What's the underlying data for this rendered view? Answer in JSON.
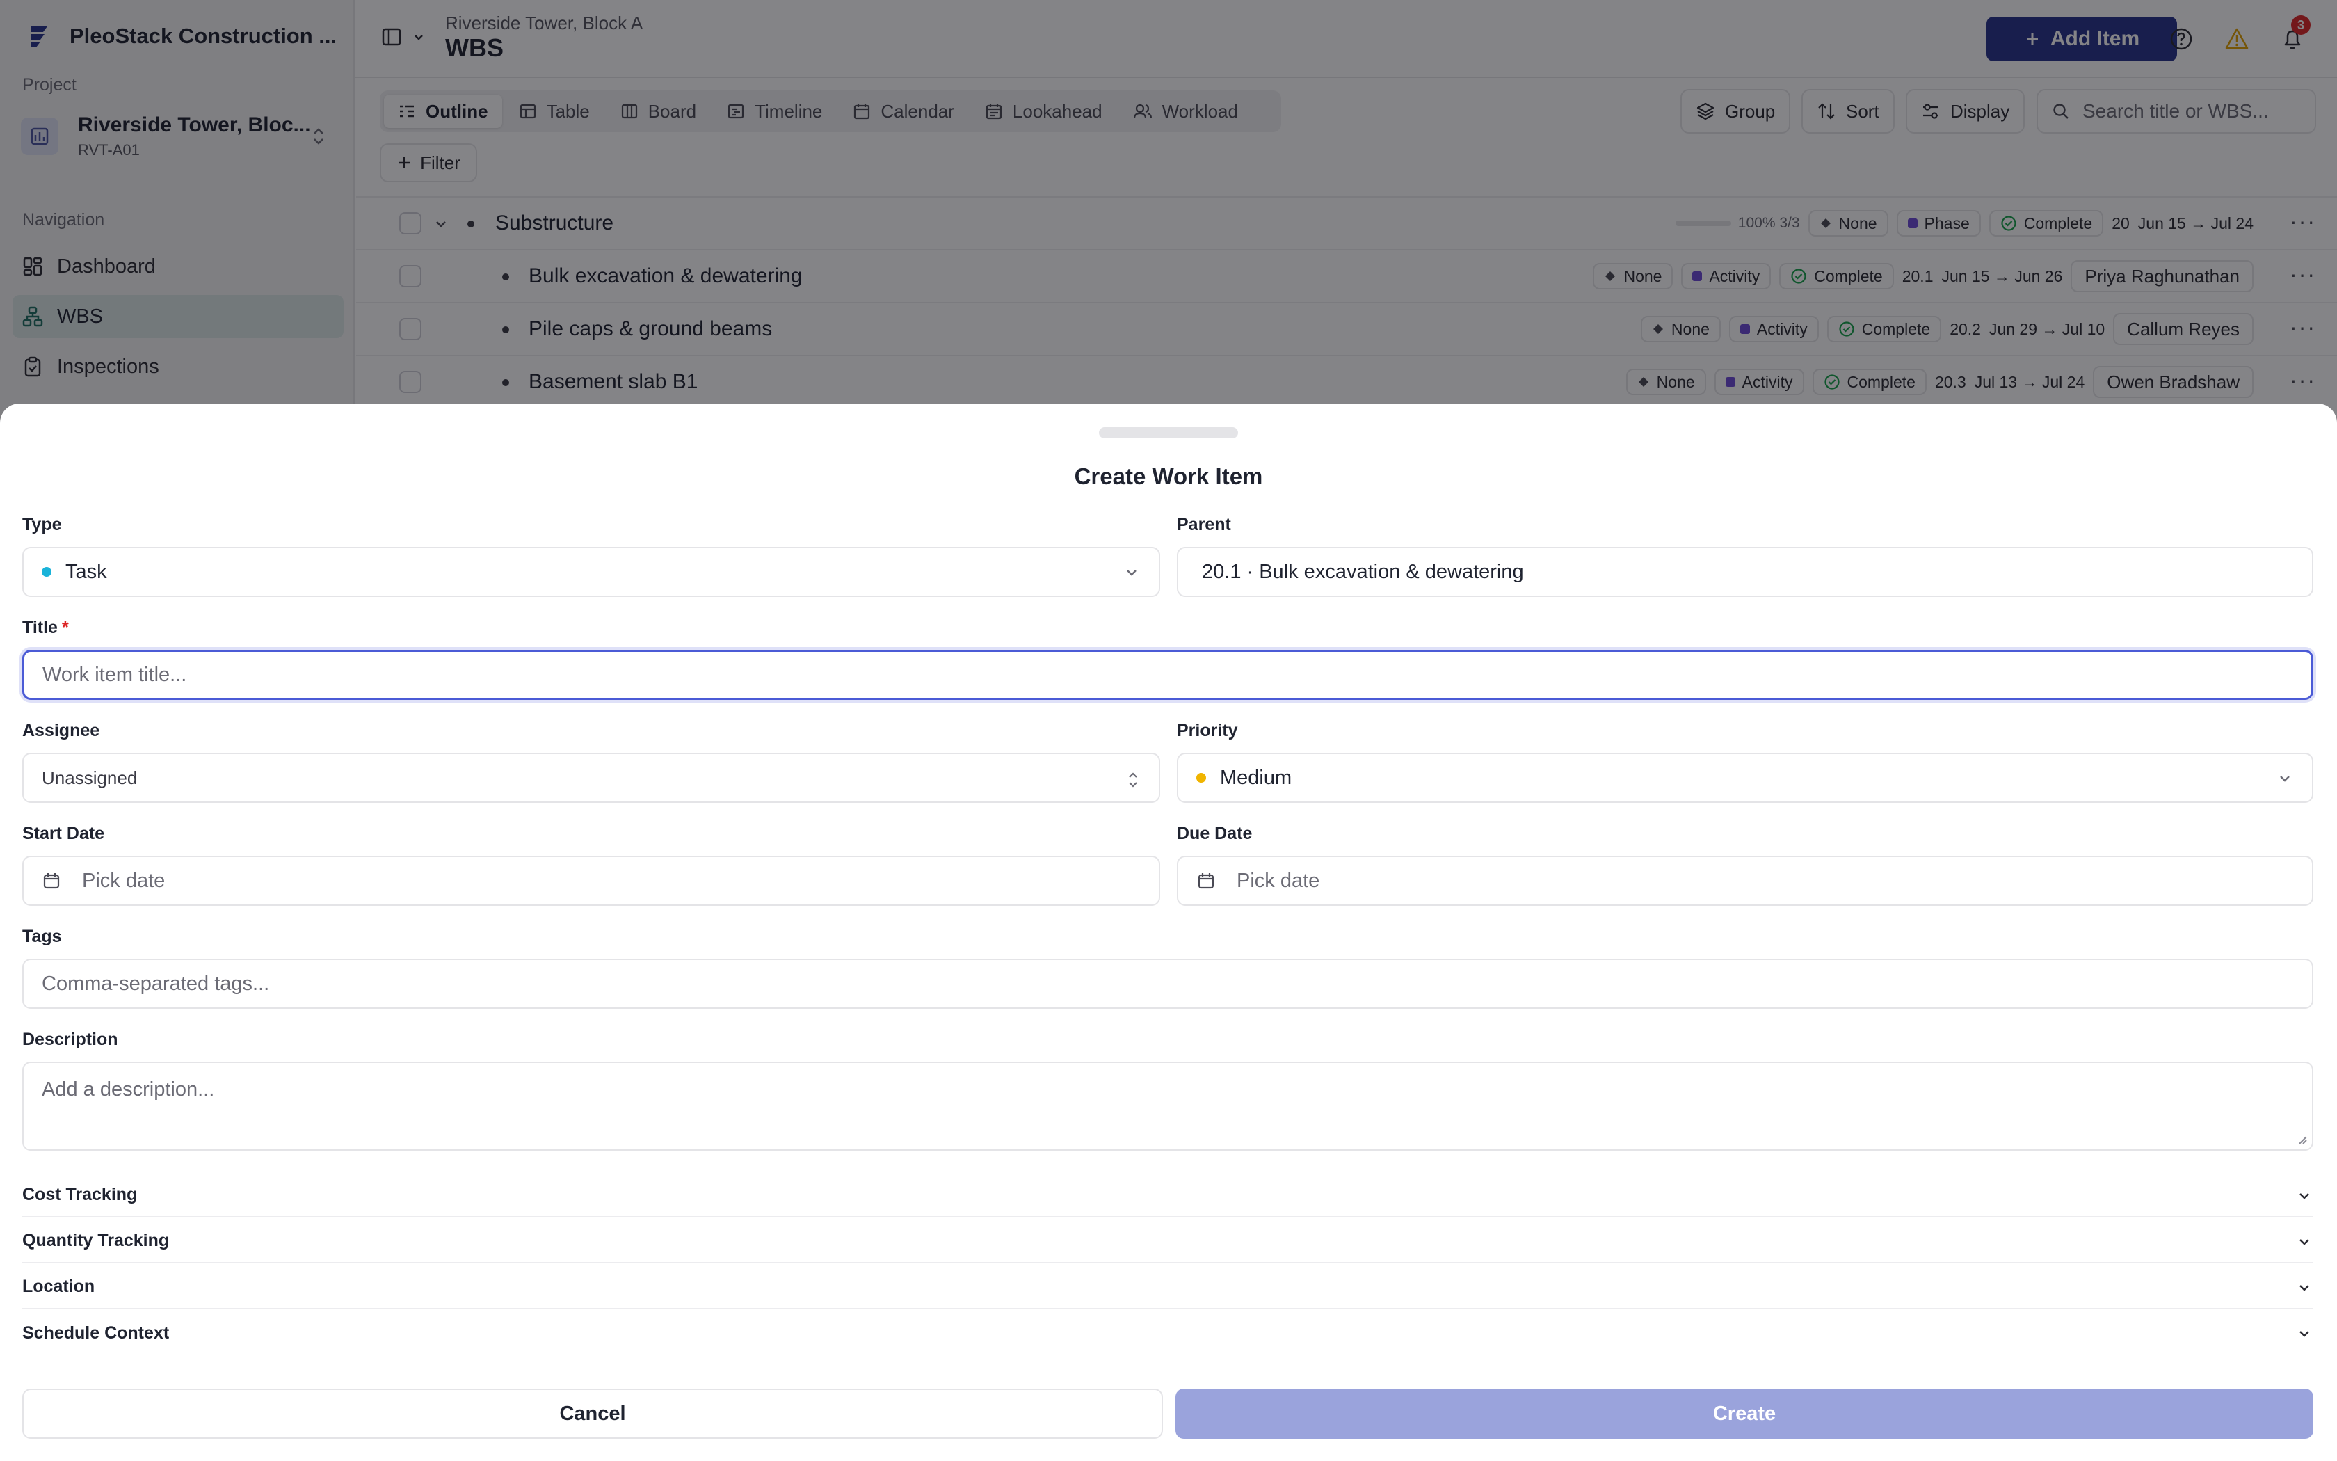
{
  "sidebar": {
    "org_name": "PleoStack Construction ...",
    "project_label": "Project",
    "project_name": "Riverside Tower, Bloc...",
    "project_code": "RVT-A01",
    "nav_label": "Navigation",
    "nav_items": [
      {
        "label": "Dashboard",
        "icon": "dashboard-icon",
        "active": false
      },
      {
        "label": "WBS",
        "icon": "hierarchy-icon",
        "active": true
      },
      {
        "label": "Inspections",
        "icon": "clipboard-check-icon",
        "active": false
      }
    ]
  },
  "header": {
    "breadcrumb": "Riverside Tower, Block A",
    "title": "WBS",
    "add_item_label": "Add Item",
    "notification_count": "3"
  },
  "view_tabs": [
    "Outline",
    "Table",
    "Board",
    "Timeline",
    "Calendar",
    "Lookahead",
    "Workload"
  ],
  "active_view": "Outline",
  "toolbar": {
    "group_label": "Group",
    "sort_label": "Sort",
    "display_label": "Display",
    "search_placeholder": "Search title or WBS...",
    "filter_label": "Filter"
  },
  "wbs_rows": [
    {
      "title": "Substructure",
      "level": 0,
      "progress_label": "100% 3/3",
      "progress_fraction": 1.0,
      "priority": "None",
      "type": "Phase",
      "status": "Complete",
      "code": "20",
      "dates": "Jun 15 → Jul 24",
      "assignee": ""
    },
    {
      "title": "Bulk excavation & dewatering",
      "level": 1,
      "priority": "None",
      "type": "Activity",
      "status": "Complete",
      "code": "20.1",
      "dates": "Jun 15 → Jun 26",
      "assignee": "Priya Raghunathan"
    },
    {
      "title": "Pile caps & ground beams",
      "level": 1,
      "priority": "None",
      "type": "Activity",
      "status": "Complete",
      "code": "20.2",
      "dates": "Jun 29 → Jul 10",
      "assignee": "Callum Reyes"
    },
    {
      "title": "Basement slab B1",
      "level": 1,
      "priority": "None",
      "type": "Activity",
      "status": "Complete",
      "code": "20.3",
      "dates": "Jul 13 → Jul 24",
      "assignee": "Owen Bradshaw"
    }
  ],
  "modal": {
    "title": "Create Work Item",
    "type_label": "Type",
    "type_value": "Task",
    "type_color": "#1ab3d9",
    "parent_label": "Parent",
    "parent_value": "20.1 · Bulk excavation & dewatering",
    "title_label": "Title",
    "required_mark": "*",
    "title_placeholder": "Work item title...",
    "assignee_label": "Assignee",
    "assignee_value": "Unassigned",
    "priority_label": "Priority",
    "priority_value": "Medium",
    "priority_color": "#f0b400",
    "start_date_label": "Start Date",
    "start_date_placeholder": "Pick date",
    "due_date_label": "Due Date",
    "due_date_placeholder": "Pick date",
    "tags_label": "Tags",
    "tags_placeholder": "Comma-separated tags...",
    "description_label": "Description",
    "description_placeholder": "Add a description...",
    "sections": [
      "Cost Tracking",
      "Quantity Tracking",
      "Location",
      "Schedule Context"
    ],
    "cancel_label": "Cancel",
    "create_label": "Create"
  },
  "colors": {
    "accent": "#26338a",
    "focus_ring": "#4b5bd6",
    "create_disabled": "#9aa3dc",
    "type_square": "#6d4bd6",
    "status_green": "#16a34a",
    "warning": "#e0a100",
    "badge": "#dc2626"
  }
}
